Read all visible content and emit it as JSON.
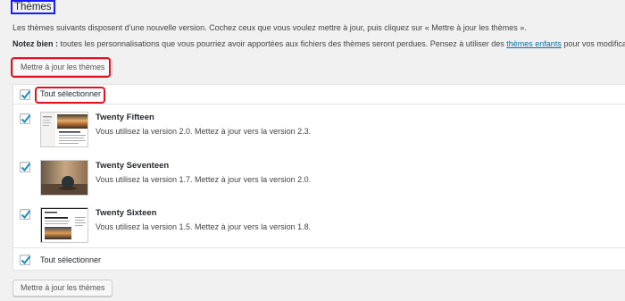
{
  "page": {
    "title": "Thèmes",
    "intro": "Les thèmes suivants disposent d’une nouvelle version. Cochez ceux que vous voulez mettre à jour, puis cliquez sur « Mettre à jour les thèmes ».",
    "note_label": "Notez bien :",
    "note_text": " toutes les personnalisations que vous pourriez avoir apportées aux fichiers des thèmes seront perdues. Pensez à utiliser des ",
    "note_link": "thèmes enfants",
    "note_end": " pour vos modifications.",
    "update_button_top": "Mettre à jour les thèmes",
    "update_button_bottom": "Mettre à jour les thèmes",
    "select_all_top": "Tout sélectionner",
    "select_all_bottom": "Tout sélectionner"
  },
  "themes": [
    {
      "name": "Twenty Fifteen",
      "description": "Vous utilisez la version 2.0. Mettez à jour vers la version 2.3.",
      "checked": true
    },
    {
      "name": "Twenty Seventeen",
      "description": "Vous utilisez la version 1.7. Mettez à jour vers la version 2.0.",
      "checked": true
    },
    {
      "name": "Twenty Sixteen",
      "description": "Vous utilisez la version 1.5. Mettez à jour vers la version 1.8.",
      "checked": true
    }
  ],
  "colors": {
    "highlight_red": "#e0141e",
    "highlight_blue": "#1a1aff",
    "link": "#0073aa",
    "checkmark": "#1e8cbe"
  }
}
